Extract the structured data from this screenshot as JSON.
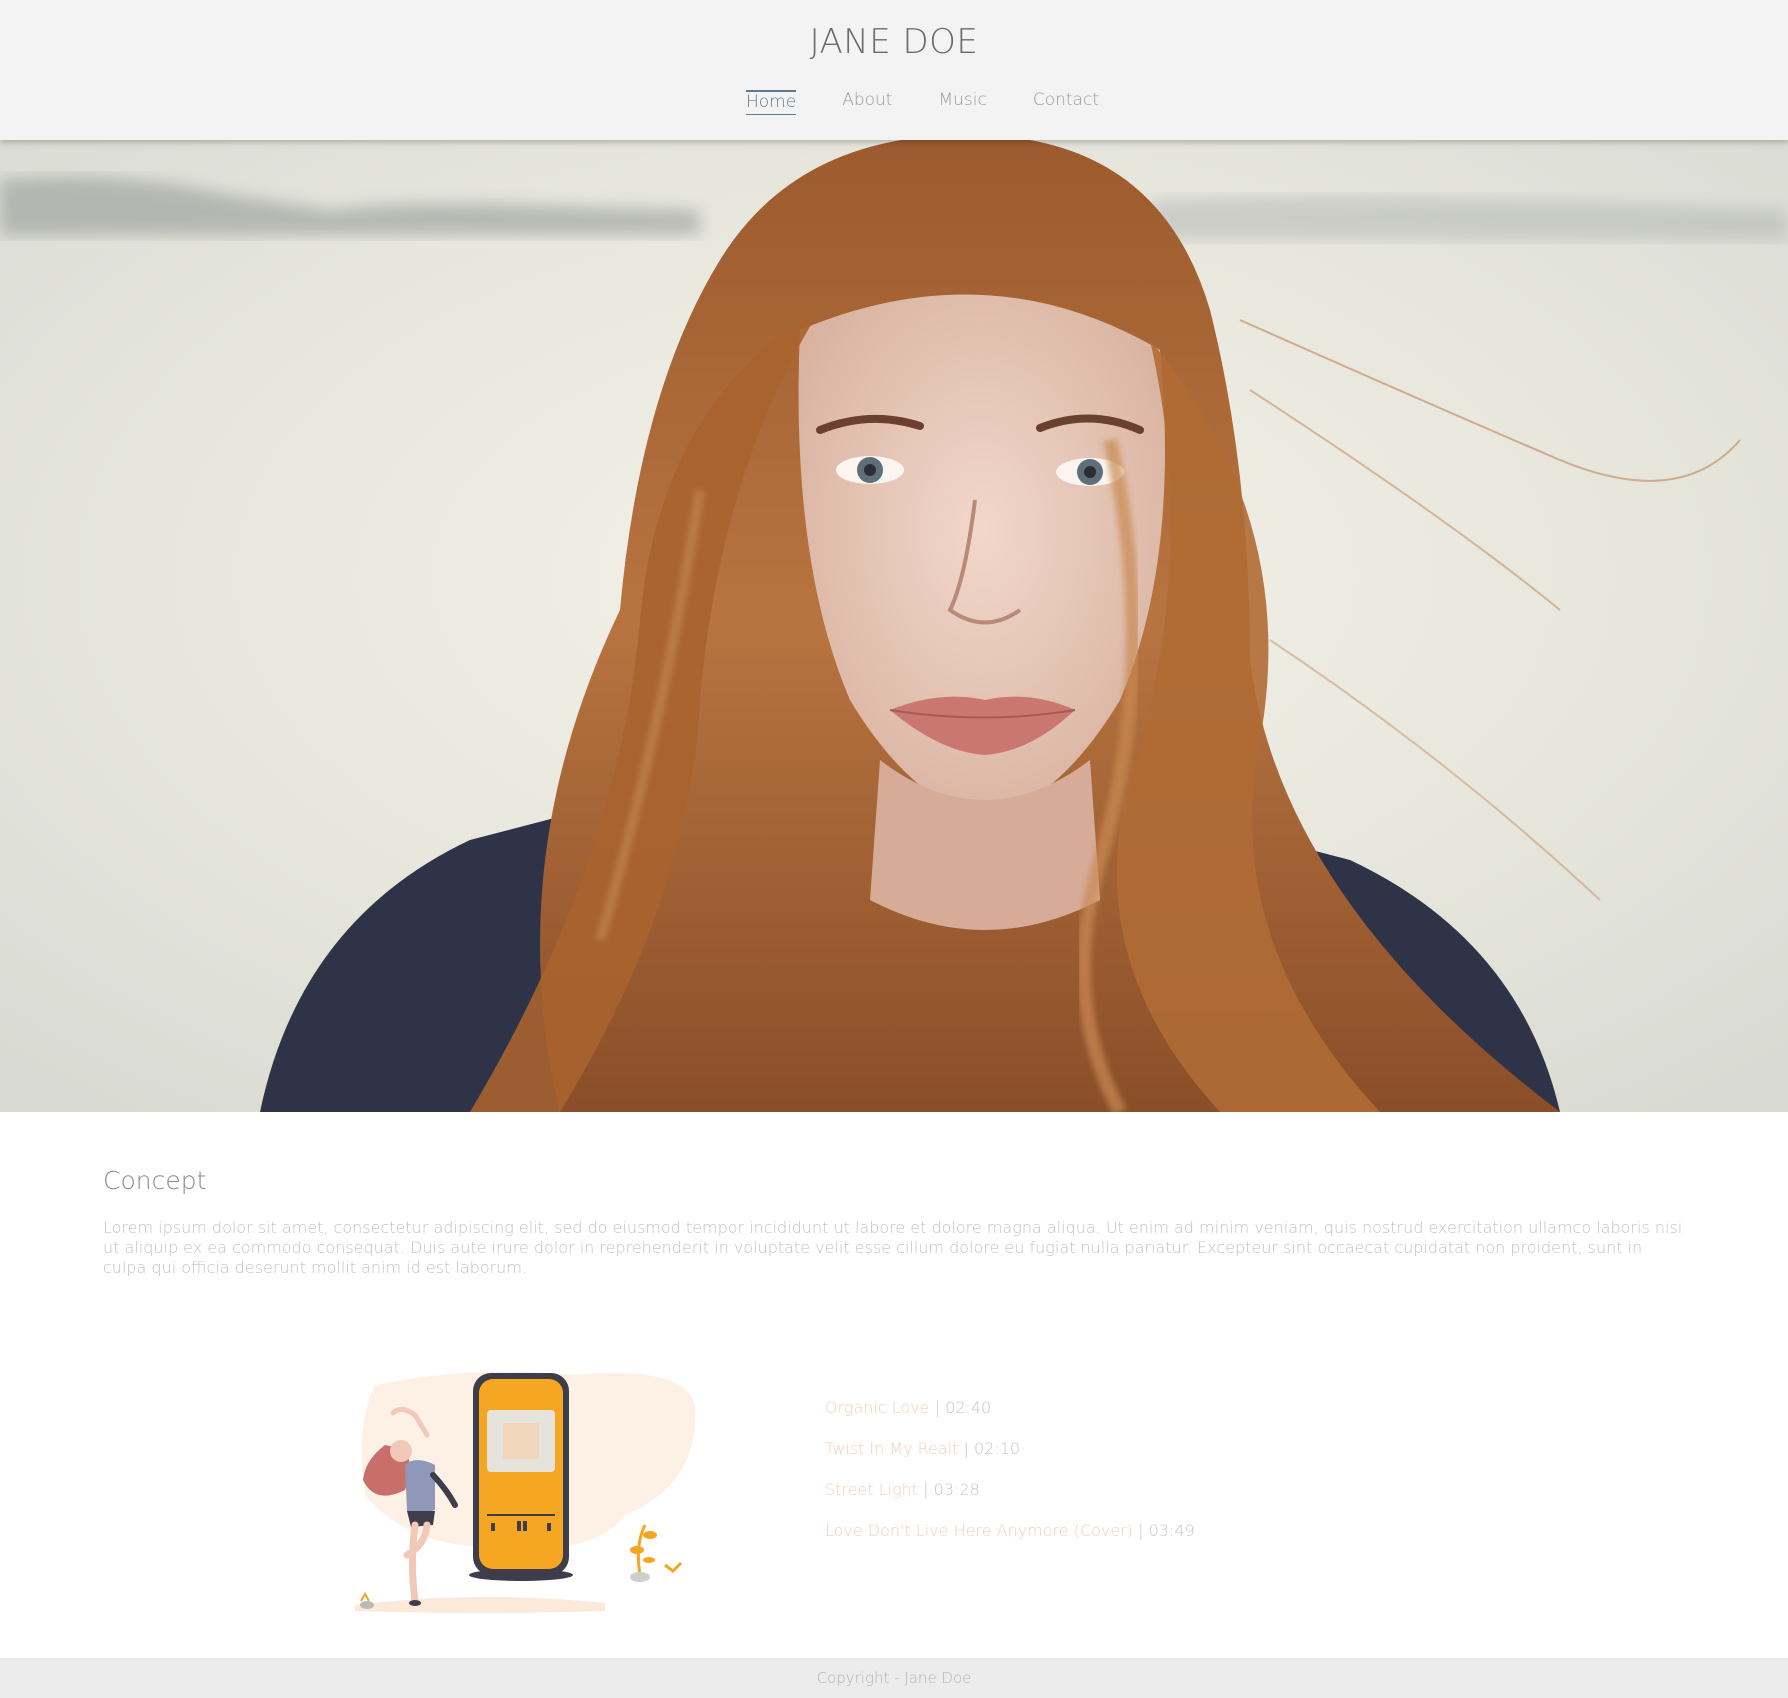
{
  "header": {
    "title": "JANE DOE",
    "nav": [
      {
        "label": "Home",
        "active": true
      },
      {
        "label": "About",
        "active": false
      },
      {
        "label": "Music",
        "active": false
      },
      {
        "label": "Contact",
        "active": false
      }
    ]
  },
  "concept": {
    "heading": "Concept",
    "body": "Lorem ipsum dolor sit amet, consectetur adipiscing elit, sed do eiusmod tempor incididunt ut labore et dolore magna aliqua. Ut enim ad minim veniam, quis nostrud exercitation ullamco laboris nisi ut aliquip ex ea commodo consequat. Duis aute irure dolor in reprehenderit in voluptate velit esse cillum dolore eu fugiat nulla pariatur. Excepteur sint occaecat cupidatat non proident, sunt in culpa qui officia deserunt mollit anim id est laborum."
  },
  "tracks": [
    {
      "title": "Organic Love",
      "separator": " | ",
      "duration": "02:40"
    },
    {
      "title": "Twist In My Realt",
      "separator": " | ",
      "duration": "02:10"
    },
    {
      "title": "Street Light",
      "separator": " | ",
      "duration": "03:28"
    },
    {
      "title": "Love Don't Live Here Anymore (Cover)",
      "separator": " | ",
      "duration": "03:49"
    }
  ],
  "footer": {
    "text": "Copyright - Jane Doe"
  },
  "colors": {
    "header_bg": "#f3f3f3",
    "nav_active": "#5d7b95",
    "track_title": "#f3cdb9",
    "phone_orange": "#f5a623",
    "footer_bg": "#ececec"
  }
}
